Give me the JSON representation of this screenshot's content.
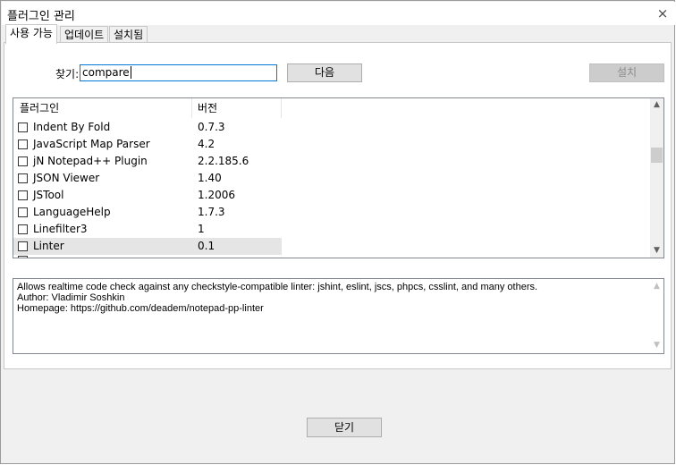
{
  "window": {
    "title": "플러그인 관리",
    "close_glyph": "×"
  },
  "tabs": [
    {
      "label": "사용 가능",
      "active": true
    },
    {
      "label": "업데이트",
      "active": false
    },
    {
      "label": "설치됨",
      "active": false
    }
  ],
  "search": {
    "label": "찾기:",
    "value": "compare"
  },
  "buttons": {
    "next": "다음",
    "install": "설치",
    "close": "닫기"
  },
  "list": {
    "columns": [
      "플러그인",
      "버전"
    ],
    "rows": [
      {
        "name": "Indent By Fold",
        "version": "0.7.3",
        "checked": false
      },
      {
        "name": "JavaScript Map Parser",
        "version": "4.2",
        "checked": false
      },
      {
        "name": "jN Notepad++ Plugin",
        "version": "2.2.185.6",
        "checked": false
      },
      {
        "name": "JSON Viewer",
        "version": "1.40",
        "checked": false
      },
      {
        "name": "JSTool",
        "version": "1.2006",
        "checked": false
      },
      {
        "name": "LanguageHelp",
        "version": "1.7.3",
        "checked": false
      },
      {
        "name": "Linefilter3",
        "version": "1",
        "checked": false
      },
      {
        "name": "Linter",
        "version": "0.1",
        "checked": false,
        "selected": true
      }
    ]
  },
  "description": {
    "lines": [
      "Allows realtime code check against any checkstyle-compatible linter: jshint, eslint, jscs, phpcs, csslint, and many others.",
      "Author: Vladimir Soshkin",
      "Homepage: https://github.com/deadem/notepad-pp-linter"
    ]
  }
}
